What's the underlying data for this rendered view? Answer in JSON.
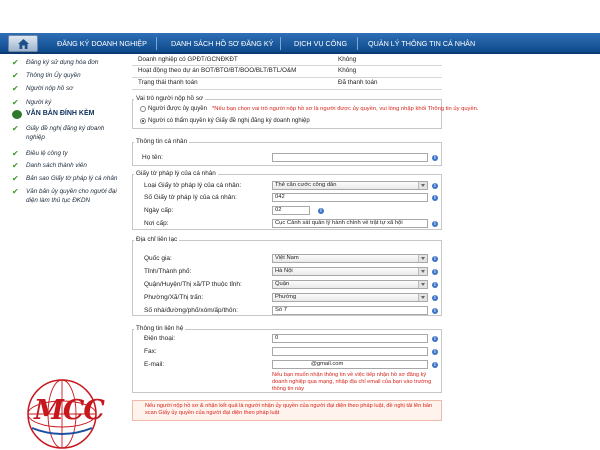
{
  "nav": {
    "items": [
      "ĐĂNG KÝ DOANH NGHIỆP",
      "DANH SÁCH HỒ SƠ ĐĂNG KÝ",
      "DỊCH VỤ CÔNG",
      "QUẢN LÝ THÔNG TIN CÁ NHÂN"
    ]
  },
  "sidebar": {
    "items": [
      "Đăng ký sử dụng hóa đơn",
      "Thông tin Ủy quyền",
      "Người nộp hồ sơ",
      "Người ký",
      "Giấy đề nghị đăng ký doanh nghiệp",
      "Điều lệ công ty",
      "Danh sách thành viên",
      "Bản sao Giấy tờ pháp lý cá nhân",
      "Văn bản ủy quyền cho người đại diện làm thủ tục ĐKDN"
    ],
    "active": "VĂN BẢN ĐÍNH KÈM"
  },
  "top_rows": [
    {
      "label": "Doanh nghiệp có GPĐT/GCNĐKĐT",
      "value": "Không"
    },
    {
      "label": "Hoạt động theo dự án BOT/BTO/BT/BOO/BLT/BTL/O&M",
      "value": "Không"
    },
    {
      "label": "Trạng thái thanh toán",
      "value": "Đã thanh toán"
    }
  ],
  "role": {
    "legend": "Vai trò người nộp hồ sơ",
    "option1": "Người được ủy quyền",
    "warning": "*Nếu bạn chọn vai trò người nộp hồ sơ là người được ủy quyền, vui lòng nhập khối Thông tin ủy quyền.",
    "option2": "Người có thẩm quyền ký Giấy đề nghị đăng ký doanh nghiệp"
  },
  "personal": {
    "legend": "Thông tin cá nhân",
    "name_label": "Họ tên:",
    "name_value": ""
  },
  "id_doc": {
    "legend": "Giấy tờ pháp lý của cá nhân",
    "type_label": "Loại Giấy tờ pháp lý của cá nhân:",
    "type_value": "Thẻ căn cước công dân",
    "number_label": "Số Giấy tờ pháp lý của cá nhân:",
    "number_value": "042",
    "date_label": "Ngày cấp:",
    "date_value": "02",
    "place_label": "Nơi cấp:",
    "place_value": "Cục Cảnh sát quản lý hành chính về trật tự xã hội"
  },
  "address": {
    "legend": "Địa chỉ liên lạc",
    "country_label": "Quốc gia:",
    "country_value": "Việt Nam",
    "province_label": "Tỉnh/Thành phố:",
    "province_value": "Hà Nội",
    "district_label": "Quận/Huyện/Thị xã/TP thuộc tỉnh:",
    "district_value": "Quận",
    "ward_label": "Phường/Xã/Thị trấn:",
    "ward_value": "Phường",
    "street_label": "Số nhà/đường/phố/xóm/ấp/thôn:",
    "street_value": "Số 7"
  },
  "contact": {
    "legend": "Thông tin liên hệ",
    "phone_label": "Điện thoại:",
    "phone_value": "0",
    "fax_label": "Fax:",
    "fax_value": "",
    "email_label": "E-mail:",
    "email_value": "@gmail.com",
    "email_note": "Nếu bạn muốn nhận thông tin về việc tiếp nhận hồ sơ đăng ký doanh nghiệp qua mạng, nhập địa chỉ email của bạn vào trường thông tin này"
  },
  "bottom_note": "Nếu người nộp hồ sơ & nhận kết quả là người nhận ủy quyền của người đại diện theo pháp luật, đề nghị tải lên bản scan Giấy ủy quyền của người đại diện theo pháp luật",
  "logo": {
    "text": "MCC"
  },
  "colors": {
    "nav": "#0e4a8c",
    "warning": "#d6251b",
    "check": "#3a9a25",
    "info": "#3d73c6"
  }
}
